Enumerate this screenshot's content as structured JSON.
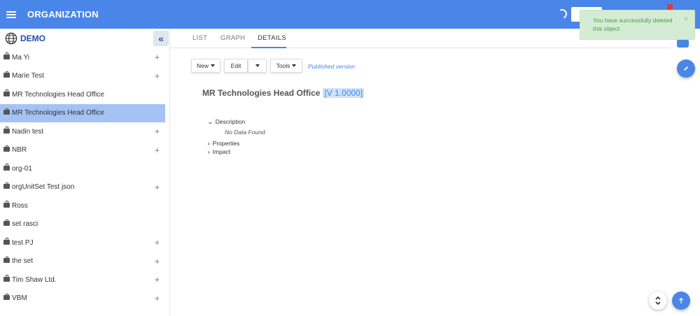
{
  "header": {
    "title": "ORGANIZATION",
    "menu_icon": "hamburger-menu-icon",
    "spinner_icon": "loading-spinner-icon"
  },
  "sidebar": {
    "org_name": "DEMO",
    "org_icon": "globe-icon",
    "collapse_label": "«",
    "items": [
      {
        "label": "Ma Yi",
        "expandable": true,
        "selected": false
      },
      {
        "label": "Marie Test",
        "expandable": true,
        "selected": false
      },
      {
        "label": "MR Technologies Head Office",
        "expandable": false,
        "selected": false
      },
      {
        "label": "MR Technologies Head Office",
        "expandable": false,
        "selected": true
      },
      {
        "label": "Nadin test",
        "expandable": true,
        "selected": false
      },
      {
        "label": "NBR",
        "expandable": true,
        "selected": false
      },
      {
        "label": "org-01",
        "expandable": false,
        "selected": false
      },
      {
        "label": "orgUnitSet Test json",
        "expandable": true,
        "selected": false
      },
      {
        "label": "Ross",
        "expandable": false,
        "selected": false
      },
      {
        "label": "set rasci",
        "expandable": false,
        "selected": false
      },
      {
        "label": "test PJ",
        "expandable": true,
        "selected": false
      },
      {
        "label": "the set",
        "expandable": true,
        "selected": false
      },
      {
        "label": "Tim Shaw Ltd.",
        "expandable": true,
        "selected": false
      },
      {
        "label": "VBM",
        "expandable": true,
        "selected": false
      }
    ],
    "plus_label": "+"
  },
  "tabs": [
    {
      "label": "LIST",
      "active": false
    },
    {
      "label": "GRAPH",
      "active": false
    },
    {
      "label": "DETAILS",
      "active": true
    }
  ],
  "toolbar": {
    "new_label": "New",
    "edit_label": "Edit",
    "tools_label": "Tools",
    "status": "Published version"
  },
  "details": {
    "title": "MR Technologies Head Office",
    "version": "[V 1.0000]",
    "sections": {
      "description": "Description",
      "no_data": "No Data Found",
      "properties": "Properties",
      "impact": "Impact"
    }
  },
  "toast": {
    "message": "You have successfully deleted this object",
    "close_label": "×"
  },
  "colors": {
    "primary": "#4a86e8",
    "selected_row": "#a4c2f4",
    "toast_bg": "#d5ecd4",
    "toast_text": "#4a9b48",
    "badge": "#e53935"
  }
}
